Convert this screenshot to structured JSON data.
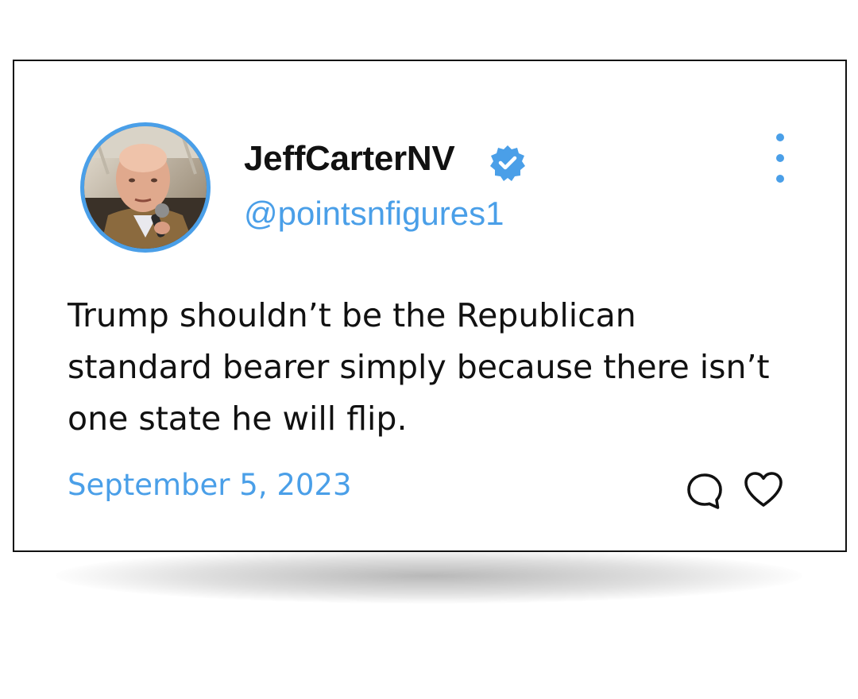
{
  "tweet": {
    "display_name": "JeffCarterNV",
    "handle": "@pointsnfigures1",
    "verified": true,
    "text": "Trump shouldn’t be the Republican standard bearer simply because there isn’t one state he will flip.",
    "date": "September 5, 2023"
  },
  "icons": {
    "verified": "verified-badge-icon",
    "more": "more-vertical-icon",
    "reply": "reply-icon",
    "like": "heart-icon"
  },
  "colors": {
    "accent": "#4a9fe8",
    "text": "#111111",
    "border": "#111111",
    "background": "#ffffff"
  }
}
